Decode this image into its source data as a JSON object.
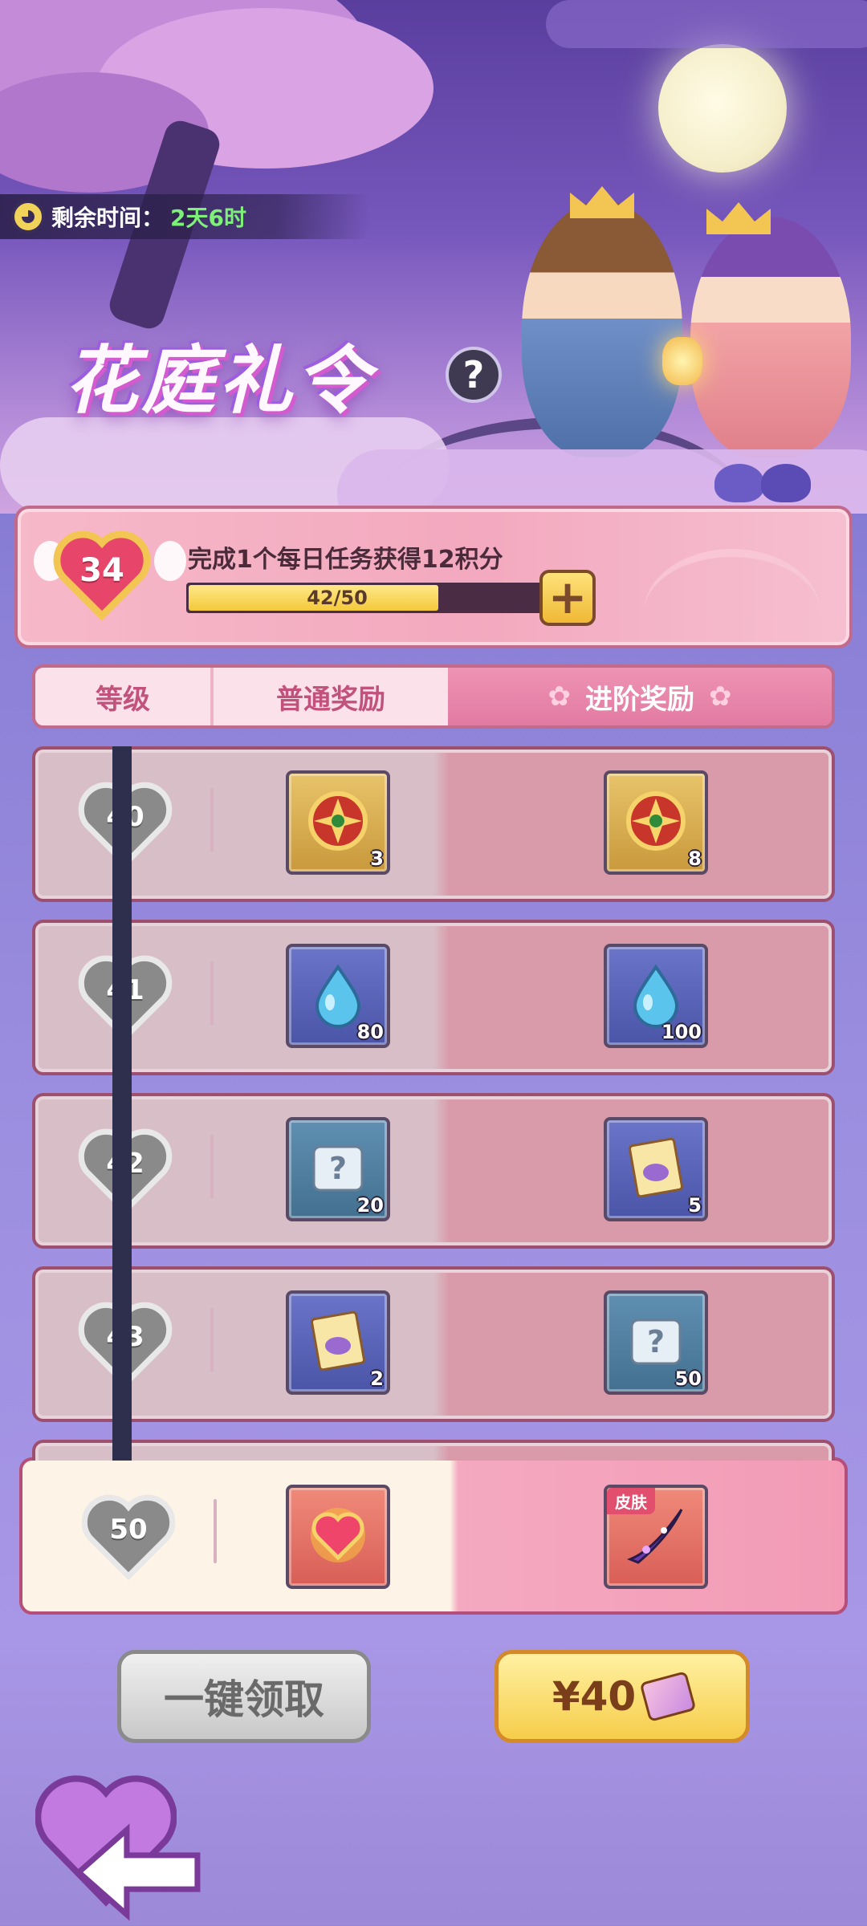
{
  "timer": {
    "label": "剩余时间：",
    "value": "2天6时"
  },
  "event": {
    "title": "花庭礼令",
    "help_icon": "question-icon"
  },
  "points": {
    "level": "34",
    "task_text": "完成1个每日任务获得12积分",
    "progress_text": "42/50",
    "progress_value": 42,
    "progress_max": 50,
    "plus_label": "+"
  },
  "header": {
    "level": "等级",
    "normal": "普通奖励",
    "advanced": "进阶奖励",
    "flower": "✿"
  },
  "rows": [
    {
      "level": "40",
      "normal": {
        "icon": "gold-badge-icon",
        "qty": "3"
      },
      "adv": {
        "icon": "gold-badge-icon",
        "qty": "8"
      }
    },
    {
      "level": "41",
      "normal": {
        "icon": "water-drop-icon",
        "qty": "80"
      },
      "adv": {
        "icon": "water-drop-icon",
        "qty": "100"
      }
    },
    {
      "level": "42",
      "normal": {
        "icon": "mystery-scroll-icon",
        "qty": "20"
      },
      "adv": {
        "icon": "ticket-scroll-icon",
        "qty": "5"
      }
    },
    {
      "level": "43",
      "normal": {
        "icon": "ticket-scroll-icon",
        "qty": "2"
      },
      "adv": {
        "icon": "mystery-scroll-icon",
        "qty": "50"
      }
    }
  ],
  "final_row": {
    "level": "50",
    "normal": {
      "icon": "heart-gem-icon"
    },
    "adv": {
      "icon": "skin-weapon-icon",
      "tag": "皮肤"
    }
  },
  "buttons": {
    "claim_all": "一键领取",
    "buy_price": "¥40",
    "back_icon": "back-arrow-icon"
  },
  "colors": {
    "accent_pink": "#e27aa2",
    "gold": "#f6cd4a",
    "progress_green": "#7ef07a"
  }
}
